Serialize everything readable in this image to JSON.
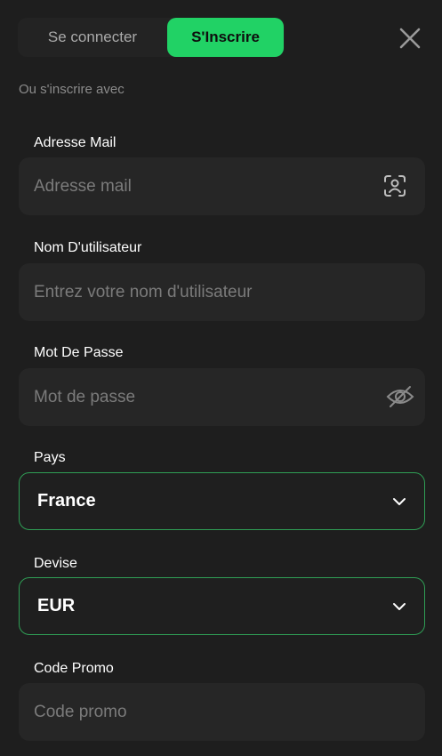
{
  "tabs": {
    "login": "Se connecter",
    "signup": "S'Inscrire"
  },
  "subtitle": "Ou s'inscrire avec",
  "fields": {
    "email": {
      "label": "Adresse Mail",
      "placeholder": "Adresse mail"
    },
    "username": {
      "label": "Nom D'utilisateur",
      "placeholder": "Entrez votre nom d'utilisateur"
    },
    "password": {
      "label": "Mot De Passe",
      "placeholder": "Mot de passe"
    },
    "country": {
      "label": "Pays",
      "value": "France"
    },
    "currency": {
      "label": "Devise",
      "value": "EUR"
    },
    "promo": {
      "label": "Code Promo",
      "placeholder": "Code promo"
    }
  },
  "icons": {
    "close": "close-icon",
    "email": "contact-scan-icon",
    "password": "eye-off-icon",
    "select": "chevron-down-icon"
  },
  "colors": {
    "accent": "#21d265",
    "background": "#1e1e1e",
    "select_border": "#2f9e55"
  }
}
